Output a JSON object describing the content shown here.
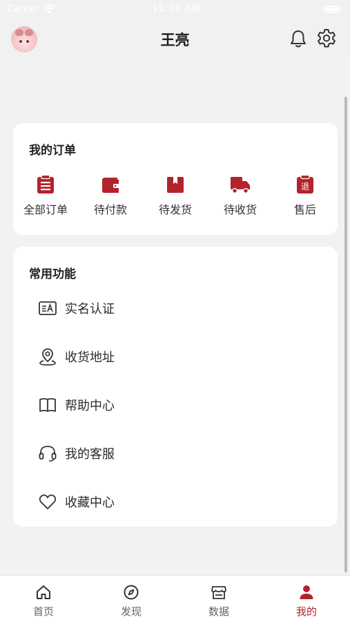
{
  "status_bar": {
    "carrier": "Carrier",
    "time": "11:06 AM"
  },
  "header": {
    "title": "王亮"
  },
  "orders": {
    "title": "我的订单",
    "items": [
      {
        "label": "全部订单",
        "icon": "clipboard-list-icon"
      },
      {
        "label": "待付款",
        "icon": "wallet-icon"
      },
      {
        "label": "待发货",
        "icon": "gift-box-icon"
      },
      {
        "label": "待收货",
        "icon": "truck-icon"
      },
      {
        "label": "售后",
        "icon": "return-icon",
        "badge": "退"
      }
    ]
  },
  "functions": {
    "title": "常用功能",
    "items": [
      {
        "label": "实名认证",
        "icon": "id-card-icon"
      },
      {
        "label": "收货地址",
        "icon": "location-pin-icon"
      },
      {
        "label": "帮助中心",
        "icon": "book-icon"
      },
      {
        "label": "我的客服",
        "icon": "headset-icon"
      },
      {
        "label": "收藏中心",
        "icon": "heart-icon"
      }
    ]
  },
  "tabs": [
    {
      "label": "首页",
      "icon": "home-icon",
      "active": false
    },
    {
      "label": "发现",
      "icon": "compass-icon",
      "active": false
    },
    {
      "label": "数据",
      "icon": "store-icon",
      "active": false
    },
    {
      "label": "我的",
      "icon": "user-icon",
      "active": true
    }
  ],
  "colors": {
    "accent": "#b3232c",
    "background": "#f2f2f3",
    "card": "#ffffff"
  }
}
